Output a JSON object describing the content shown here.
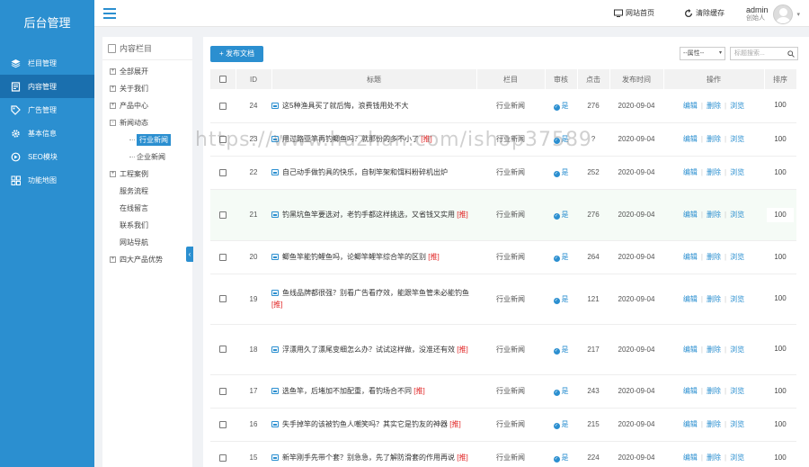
{
  "brand": {
    "title": "后台管理"
  },
  "sidebar": {
    "items": [
      {
        "label": "栏目管理",
        "icon": "layers-icon"
      },
      {
        "label": "内容管理",
        "icon": "document-icon",
        "active": true
      },
      {
        "label": "广告管理",
        "icon": "tag-icon"
      },
      {
        "label": "基本信息",
        "icon": "gear-icon"
      },
      {
        "label": "SEO模块",
        "icon": "seo-icon"
      },
      {
        "label": "功能地图",
        "icon": "grid-icon"
      }
    ]
  },
  "header": {
    "site_home": "网站首页",
    "clear_cache": "清除缓存",
    "user_name": "admin",
    "user_role": "创始人"
  },
  "categories": {
    "title": "内容栏目",
    "nodes": [
      {
        "label": "全部展开",
        "box": "+",
        "level": 0
      },
      {
        "label": "关于我们",
        "box": "+",
        "level": 0
      },
      {
        "label": "产品中心",
        "box": "+",
        "level": 0
      },
      {
        "label": "新闻动态",
        "box": "-",
        "level": 0
      },
      {
        "label": "行业新闻",
        "box": "",
        "level": 1,
        "selected": true
      },
      {
        "label": "企业新闻",
        "box": "",
        "level": 1
      },
      {
        "label": "工程案例",
        "box": "+",
        "level": 0
      },
      {
        "label": "服务流程",
        "box": "",
        "level": 0
      },
      {
        "label": "在线留言",
        "box": "",
        "level": 0
      },
      {
        "label": "联系我们",
        "box": "",
        "level": 0
      },
      {
        "label": "网站导航",
        "box": "",
        "level": 0
      },
      {
        "label": "四大产品优势",
        "box": "+",
        "level": 0
      }
    ],
    "collapse_glyph": "‹"
  },
  "toolbar": {
    "publish_label": "+ 发布文档",
    "attr_select": "--属性--",
    "search_placeholder": "标题搜索..."
  },
  "table": {
    "headers": [
      "",
      "ID",
      "标题",
      "栏目",
      "审核",
      "点击",
      "发布时间",
      "操作",
      "排序"
    ],
    "ops": {
      "edit": "编辑",
      "delete": "删除",
      "view": "浏览"
    },
    "rows": [
      {
        "id": "24",
        "title": "这5种渔具买了就后悔，浪费钱用处不大",
        "rec": "",
        "column": "行业新闻",
        "audit": "是",
        "clicks": "276",
        "date": "2020-09-04",
        "sort": "100",
        "h": 37
      },
      {
        "id": "23",
        "title": "用过路亚竿再钓鲫鱼吗？就那份的多不小了",
        "rec": "[推]",
        "column": "行业新闻",
        "audit": "是",
        "clicks": "?",
        "date": "2020-09-04",
        "sort": "100",
        "h": 37
      },
      {
        "id": "22",
        "title": "自己动手做钓具的快乐，自制竿架和饵料粉碎机出炉",
        "rec": "",
        "column": "行业新闻",
        "audit": "是",
        "clicks": "252",
        "date": "2020-09-04",
        "sort": "100",
        "h": 37
      },
      {
        "id": "21",
        "title": "钓黑坑鱼竿要选对，老钓手都这样挑选，又省钱又实用",
        "rec": "[推]",
        "column": "行业新闻",
        "audit": "是",
        "clicks": "276",
        "date": "2020-09-04",
        "sort": "100",
        "h": 57,
        "hl": true
      },
      {
        "id": "20",
        "title": "鲫鱼竿能钓鲤鱼吗，论鲫竿鲤竿综合竿的区别",
        "rec": "[推]",
        "column": "行业新闻",
        "audit": "是",
        "clicks": "264",
        "date": "2020-09-04",
        "sort": "100",
        "h": 37
      },
      {
        "id": "19",
        "title": "鱼线品牌都很强？别看广告看疗效，能跟竿鱼管未必能钓鱼",
        "rec": "[推]",
        "column": "行业新闻",
        "audit": "是",
        "clicks": "121",
        "date": "2020-09-04",
        "sort": "100",
        "h": 56
      },
      {
        "id": "18",
        "title": "浮漂用久了漂尾变细怎么办？试试这样做，没准还有效",
        "rec": "[推]",
        "column": "行业新闻",
        "audit": "是",
        "clicks": "217",
        "date": "2020-09-04",
        "sort": "100",
        "h": 56
      },
      {
        "id": "17",
        "title": "选鱼竿，后堵加不加配重，看钓场合不同",
        "rec": "[推]",
        "column": "行业新闻",
        "audit": "是",
        "clicks": "243",
        "date": "2020-09-04",
        "sort": "100",
        "h": 37
      },
      {
        "id": "16",
        "title": "失手掉竿的该被钓鱼人嘲笑吗？其实它是钓友的神器",
        "rec": "[推]",
        "column": "行业新闻",
        "audit": "是",
        "clicks": "215",
        "date": "2020-09-04",
        "sort": "100",
        "h": 37
      },
      {
        "id": "15",
        "title": "新竿刚手先带个套？别急急，先了解防滑套的作用再说",
        "rec": "[推]",
        "column": "行业新闻",
        "audit": "是",
        "clicks": "224",
        "date": "2020-09-04",
        "sort": "100",
        "h": 37
      }
    ]
  },
  "watermark": "https://www.huzhan.com/ishop37589",
  "colors": {
    "primary": "#2b8fd0",
    "primary_dark": "#1a6fae",
    "recommend": "#e02020"
  }
}
